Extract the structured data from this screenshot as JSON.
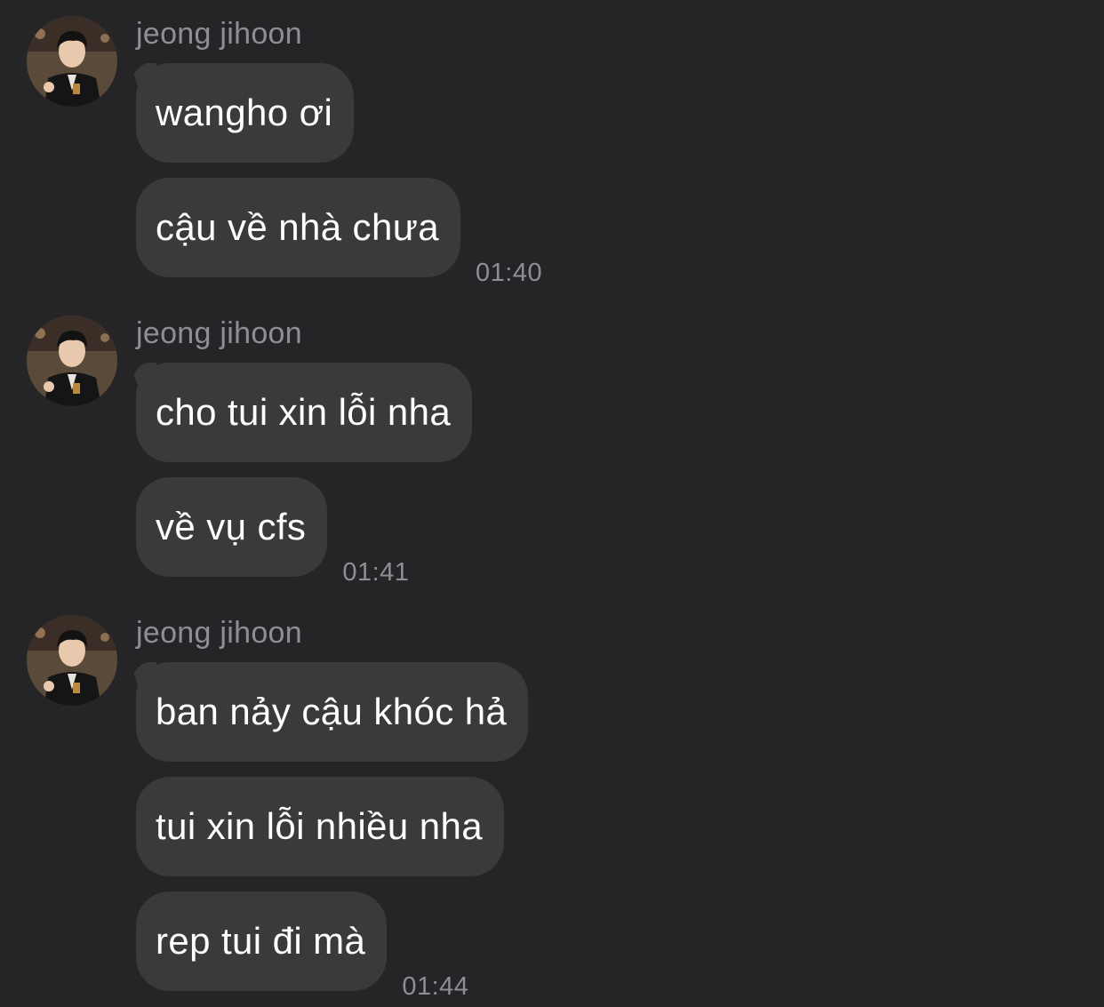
{
  "chat": {
    "background_color": "#252527",
    "bubble_color": "#3a3a3c",
    "groups": [
      {
        "sender": "jeong jihoon",
        "avatar_icon": "user-avatar-photo",
        "messages": [
          "wangho ơi",
          "cậu về nhà chưa"
        ],
        "time": "01:40"
      },
      {
        "sender": "jeong jihoon",
        "avatar_icon": "user-avatar-photo",
        "messages": [
          "cho tui xin lỗi nha",
          "về vụ cfs"
        ],
        "time": "01:41"
      },
      {
        "sender": "jeong jihoon",
        "avatar_icon": "user-avatar-photo",
        "messages": [
          "ban nảy cậu khóc hả",
          "tui xin lỗi nhiều nha",
          "rep tui đi mà"
        ],
        "time": "01:44"
      }
    ]
  }
}
